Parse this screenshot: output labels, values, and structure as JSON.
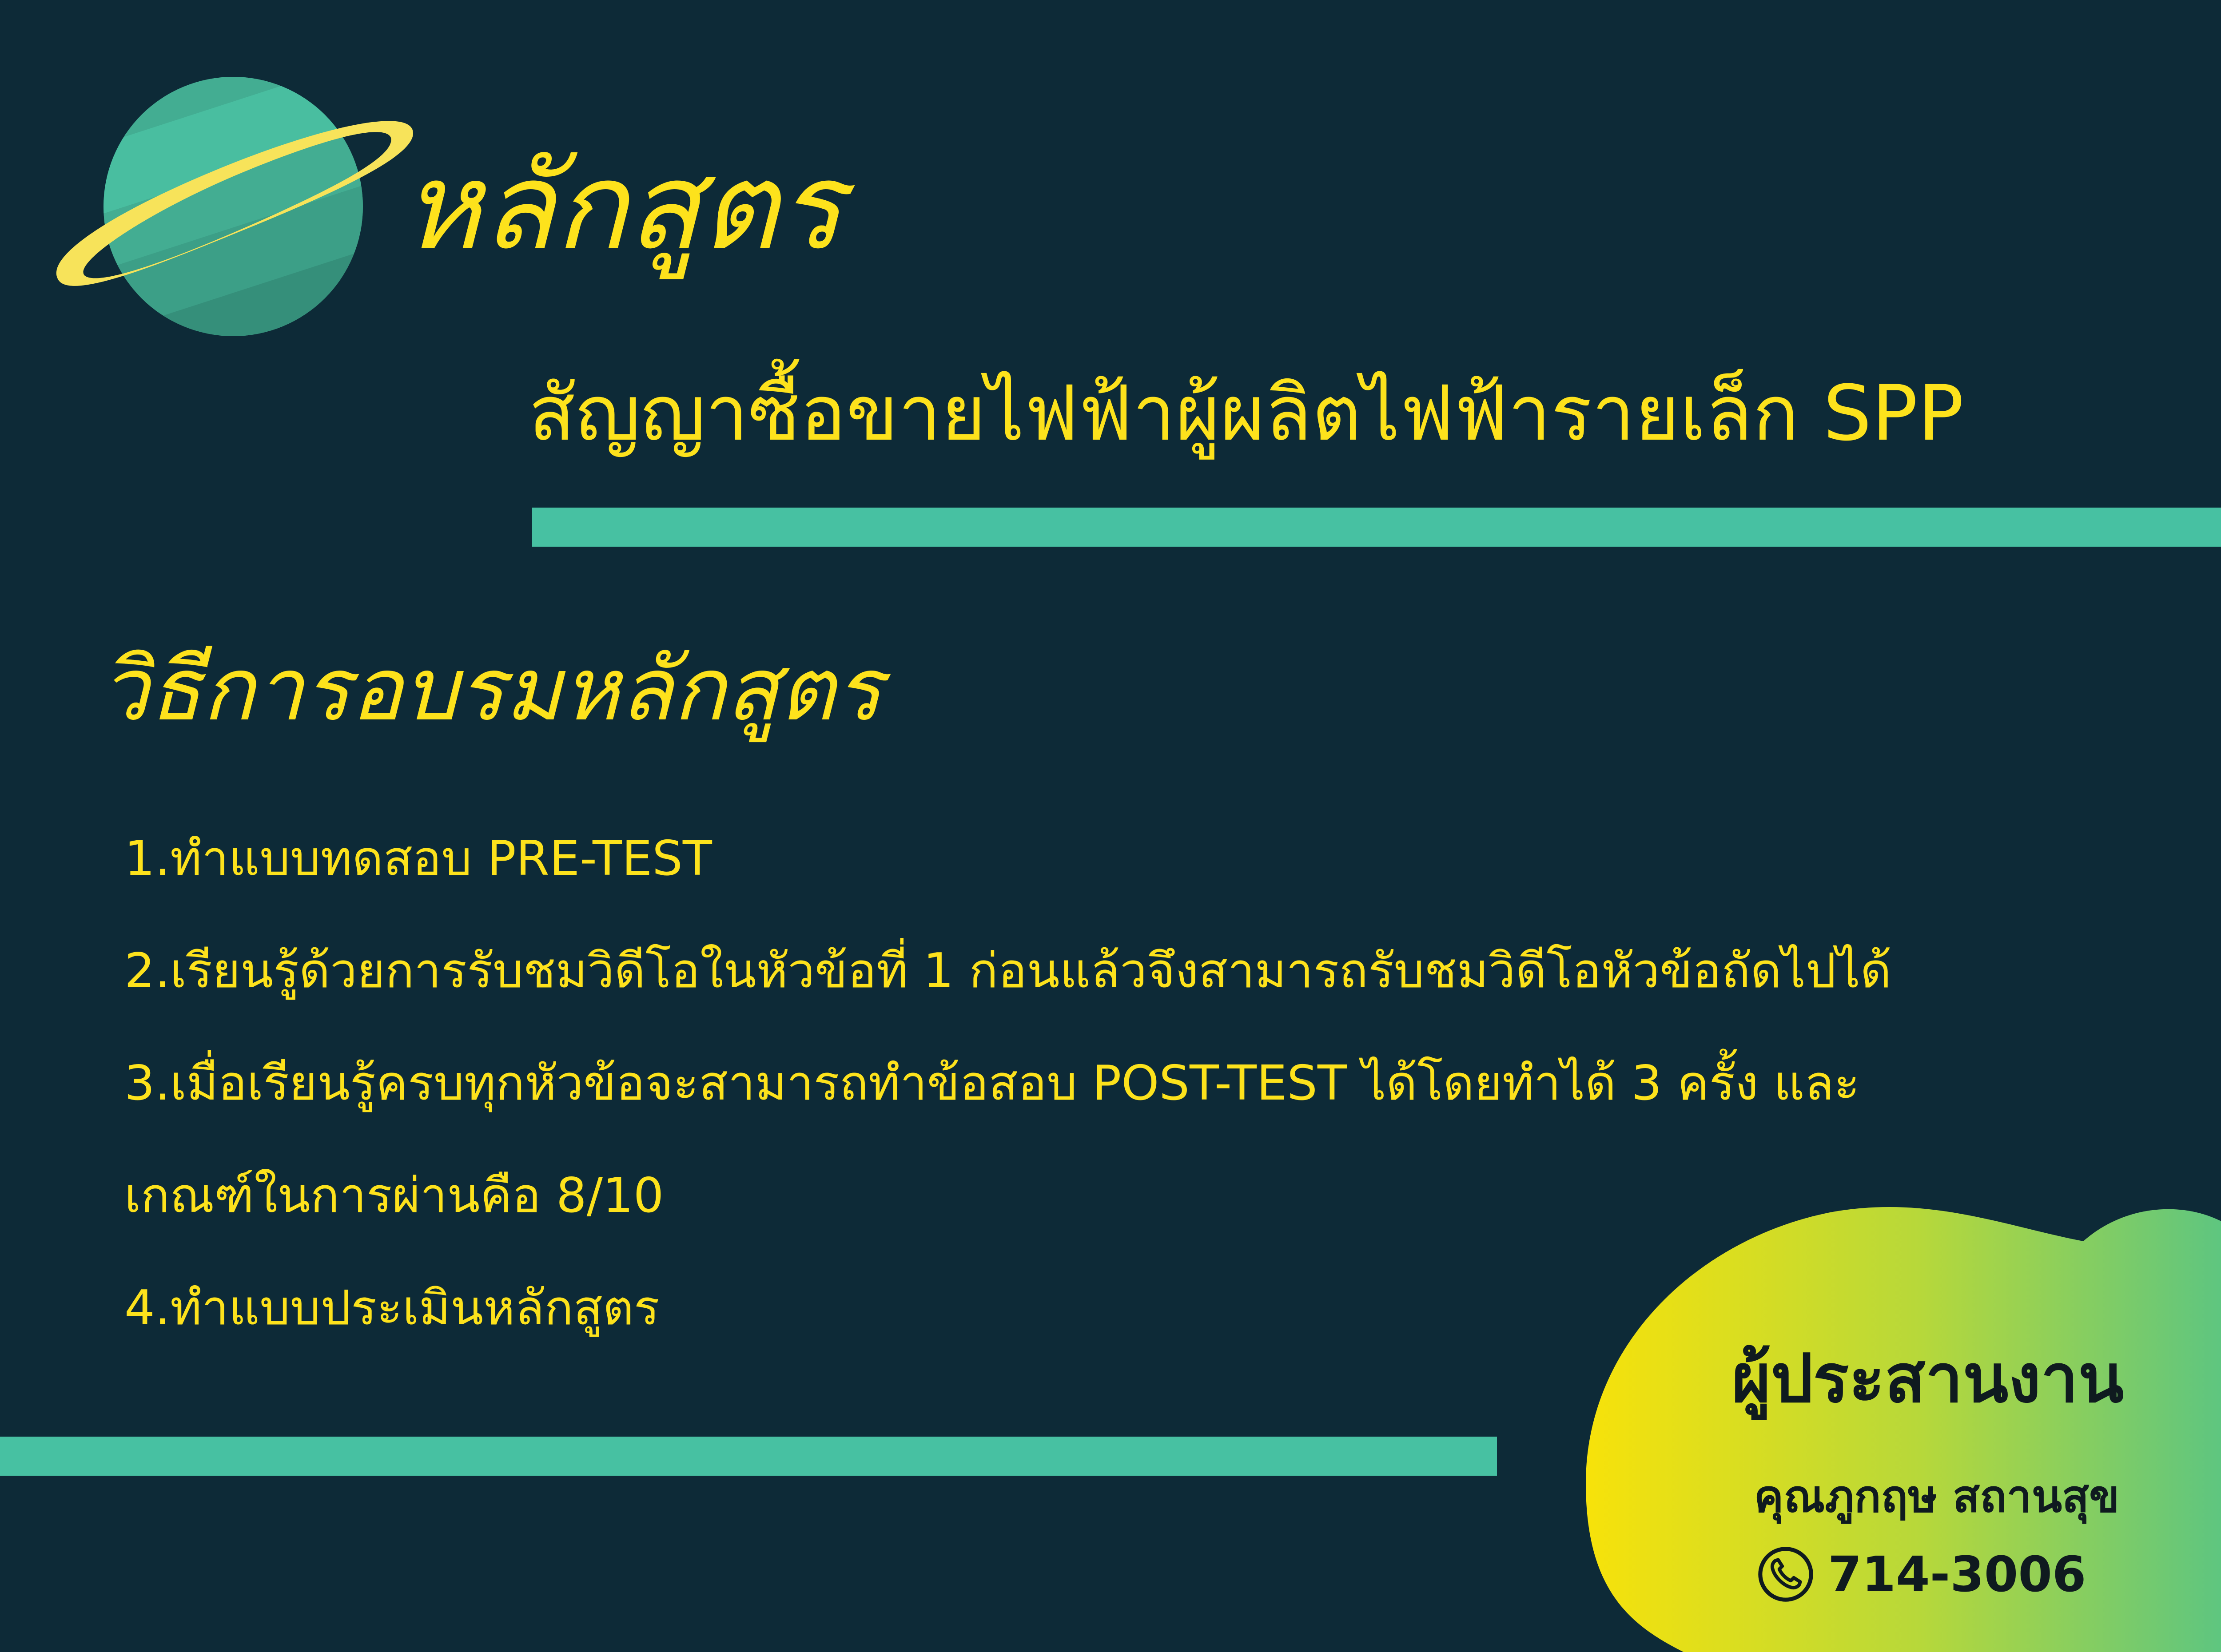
{
  "header": {
    "title": "หลักสูตร",
    "subtitle": "สัญญาซื้อขายไฟฟ้าผู้ผลิตไฟฟ้ารายเล็ก SPP"
  },
  "method": {
    "heading": "วิธีการอบรมหลักสูตร",
    "steps": [
      "1.ทำแบบทดสอบ PRE-TEST",
      "2.เรียนรู้ด้วยการรับชมวิดีโอในหัวข้อที่ 1 ก่อนแล้วจึงสามารถรับชมวิดีโอหัวข้อถัดไปได้",
      "3.เมื่อเรียนรู้ครบทุกหัวข้อจะสามารถทำข้อสอบ POST-TEST ได้โดยทำได้ 3 ครั้ง และ",
      "เกณฑ์ในการผ่านคือ 8/10",
      "4.ทำแบบประเมินหลักสูตร"
    ]
  },
  "coordinator": {
    "label": "ผู้ประสานงาน",
    "name": "คุณภูกฤษ สถานสุข",
    "phone": "714-3006"
  },
  "colors": {
    "background": "#0d2a37",
    "accent_yellow": "#fde21c",
    "accent_teal": "#47c1a2"
  },
  "icons": {
    "planet": "planet-icon",
    "phone": "phone-icon"
  }
}
